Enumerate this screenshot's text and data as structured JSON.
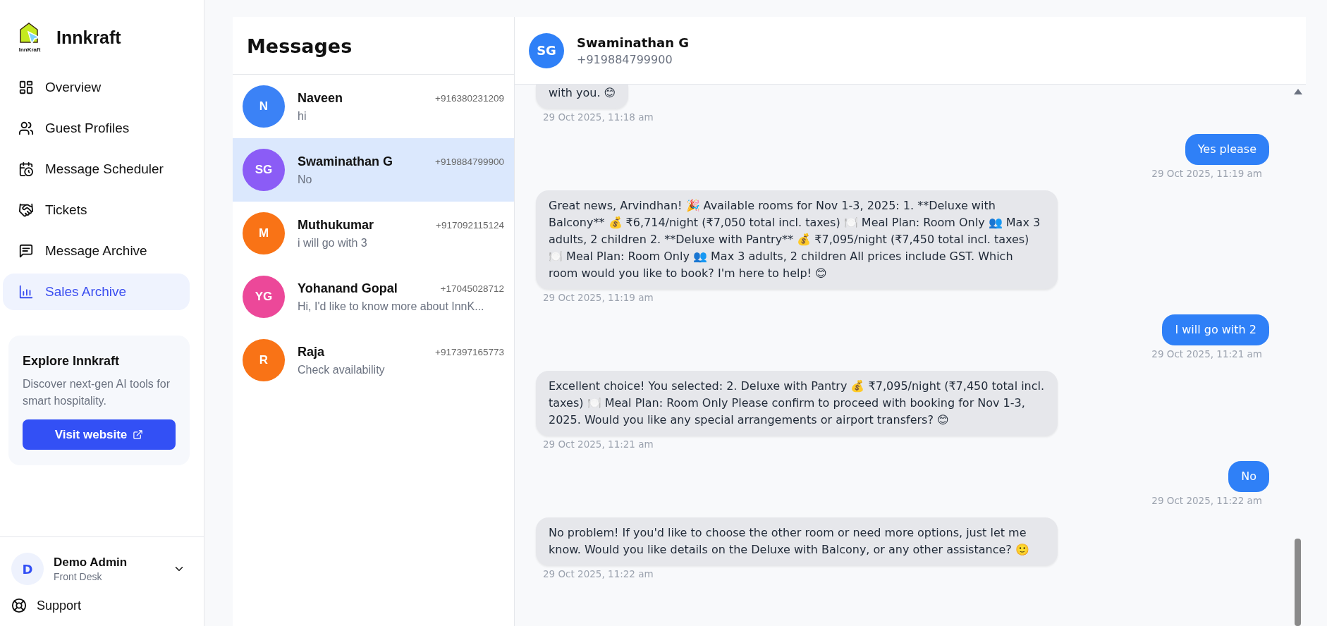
{
  "brand": {
    "name": "Innkraft",
    "logo_caption": "InnKraft"
  },
  "nav": [
    {
      "label": "Overview",
      "selected": false
    },
    {
      "label": "Guest Profiles",
      "selected": false
    },
    {
      "label": "Message Scheduler",
      "selected": false
    },
    {
      "label": "Tickets",
      "selected": false
    },
    {
      "label": "Message Archive",
      "selected": false
    },
    {
      "label": "Sales Archive",
      "selected": true
    }
  ],
  "promo": {
    "title": "Explore Innkraft",
    "text": "Discover next-gen AI tools for smart hospitality.",
    "button": "Visit website"
  },
  "user": {
    "initial": "D",
    "name": "Demo Admin",
    "role": "Front Desk"
  },
  "support": "Support",
  "conversations_title": "Messages",
  "conversations": [
    {
      "initials": "N",
      "name": "Naveen",
      "phone": "+916380231209",
      "preview": "hi",
      "color": "#3b82f6",
      "selected": false
    },
    {
      "initials": "SG",
      "name": "Swaminathan G",
      "phone": "+919884799900",
      "preview": "No",
      "color": "#8b5cf6",
      "selected": true
    },
    {
      "initials": "M",
      "name": "Muthukumar",
      "phone": "+917092115124",
      "preview": "i will go with 3",
      "color": "#f97316",
      "selected": false
    },
    {
      "initials": "YG",
      "name": "Yohanand Gopal",
      "phone": "+17045028712",
      "preview": "Hi, I'd like to know more about InnK...",
      "color": "#ec4899",
      "selected": false
    },
    {
      "initials": "R",
      "name": "Raja",
      "phone": "+917397165773",
      "preview": "Check availability",
      "color": "#f97316",
      "selected": false
    }
  ],
  "chat": {
    "initials": "SG",
    "name": "Swaminathan G",
    "phone": "+919884799900",
    "messages": [
      {
        "kind": "incoming",
        "text": "with you. 😊",
        "time": "29 Oct 2025, 11:18 am"
      },
      {
        "kind": "outgoing",
        "text": "Yes please",
        "time": "29 Oct 2025, 11:19 am"
      },
      {
        "kind": "incoming",
        "text": "Great news, Arvindhan! 🎉 Available rooms for Nov 1-3, 2025: 1. **Deluxe with Balcony** 💰 ₹6,714/night (₹7,050 total incl. taxes) 🍽️ Meal Plan: Room Only 👥 Max 3 adults, 2 children 2. **Deluxe with Pantry** 💰 ₹7,095/night (₹7,450 total incl. taxes) 🍽️ Meal Plan: Room Only 👥 Max 3 adults, 2 children All prices include GST. Which room would you like to book? I'm here to help! 😊",
        "time": "29 Oct 2025, 11:19 am"
      },
      {
        "kind": "outgoing",
        "text": "I will go with 2",
        "time": "29 Oct 2025, 11:21 am"
      },
      {
        "kind": "incoming",
        "text": "Excellent choice! You selected: 2. Deluxe with Pantry 💰 ₹7,095/night (₹7,450 total incl. taxes) 🍽️ Meal Plan: Room Only Please confirm to proceed with booking for Nov 1-3, 2025. Would you like any special arrangements or airport transfers? 😊",
        "time": "29 Oct 2025, 11:21 am"
      },
      {
        "kind": "outgoing",
        "text": "No",
        "time": "29 Oct 2025, 11:22 am"
      },
      {
        "kind": "incoming",
        "text": "No problem! If you'd like to choose the other room or need more options, just let me know. Would you like details on the Deluxe with Balcony, or any other assistance? 🙂",
        "time": "29 Oct 2025, 11:22 am"
      }
    ]
  }
}
